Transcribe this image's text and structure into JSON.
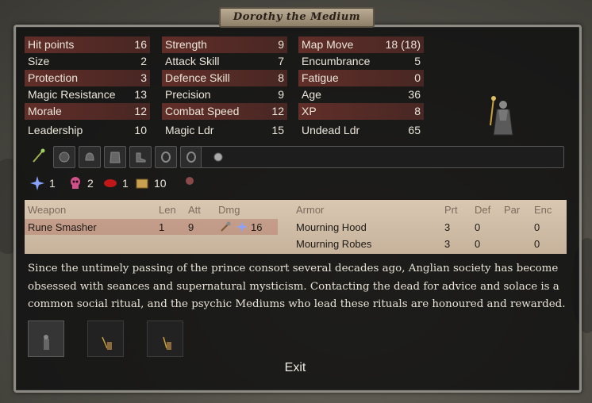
{
  "title": "Dorothy the Medium",
  "stats": {
    "col1": [
      {
        "label": "Hit points",
        "value": "16",
        "hl": true
      },
      {
        "label": "Size",
        "value": "2",
        "hl": false
      },
      {
        "label": "Protection",
        "value": "3",
        "hl": true
      },
      {
        "label": "Magic Resistance",
        "value": "13",
        "hl": false
      },
      {
        "label": "Morale",
        "value": "12",
        "hl": true
      },
      {
        "label": "Leadership",
        "value": "10",
        "hl": false
      }
    ],
    "col2": [
      {
        "label": "Strength",
        "value": "9",
        "hl": true
      },
      {
        "label": "Attack Skill",
        "value": "7",
        "hl": false
      },
      {
        "label": "Defence Skill",
        "value": "8",
        "hl": true
      },
      {
        "label": "Precision",
        "value": "9",
        "hl": false
      },
      {
        "label": "Combat Speed",
        "value": "12",
        "hl": true
      },
      {
        "label": "Magic Ldr",
        "value": "15",
        "hl": false
      }
    ],
    "col3": [
      {
        "label": "Map Move",
        "value": "18 (18)",
        "hl": true
      },
      {
        "label": "Encumbrance",
        "value": "5",
        "hl": false
      },
      {
        "label": "Fatigue",
        "value": "0",
        "hl": true
      },
      {
        "label": "Age",
        "value": "36",
        "hl": false
      },
      {
        "label": "XP",
        "value": "8",
        "hl": true
      },
      {
        "label": "Undead Ldr",
        "value": "65",
        "hl": false
      }
    ]
  },
  "equipment_icons": [
    "staff-icon",
    "shield-icon",
    "helmet-icon",
    "armor-icon",
    "boots-icon",
    "ring-icon",
    "ring-icon",
    "orb-icon"
  ],
  "magic": [
    {
      "icon": "astral-icon",
      "value": "1",
      "color": "#6f8cff"
    },
    {
      "icon": "death-icon",
      "value": "2",
      "color": "#d0508a"
    },
    {
      "icon": "blood-icon",
      "value": "1",
      "color": "#c01818"
    },
    {
      "icon": "gold-icon",
      "value": "10",
      "color": "#c8a050"
    }
  ],
  "weapons": {
    "headers": {
      "weapon": "Weapon",
      "len": "Len",
      "att": "Att",
      "dmg": "Dmg"
    },
    "rows": [
      {
        "name": "Rune Smasher",
        "len": "1",
        "att": "9",
        "dmg": "16"
      }
    ]
  },
  "armor": {
    "headers": {
      "armor": "Armor",
      "prt": "Prt",
      "def": "Def",
      "par": "Par",
      "enc": "Enc"
    },
    "rows": [
      {
        "name": "Mourning Hood",
        "prt": "3",
        "def": "0",
        "par": "",
        "enc": "0"
      },
      {
        "name": "Mourning Robes",
        "prt": "3",
        "def": "0",
        "par": "",
        "enc": "0"
      }
    ]
  },
  "description": "Since the untimely passing of the prince consort several decades ago, Anglian society has become obsessed with seances and supernatural mysticism. Contacting the dead for advice and solace is a common social ritual, and the psychic Mediums who lead these rituals are honoured and rewarded.",
  "exit_label": "Exit"
}
